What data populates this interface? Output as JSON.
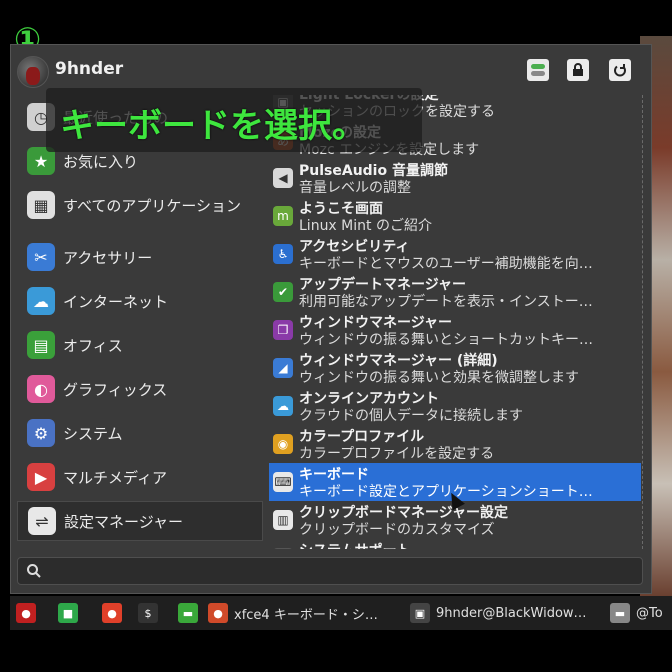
{
  "step_badge": "①",
  "user": {
    "name": "9hnder"
  },
  "overlay_caption": "キーボードを選択。",
  "categories": [
    {
      "label": "最近使ったもの",
      "icon": "clock-icon",
      "color": "#d0d0d0"
    },
    {
      "label": "お気に入り",
      "icon": "star-folder-icon",
      "color": "#3a9a3a"
    },
    {
      "label": "すべてのアプリケーション",
      "icon": "grid-icon",
      "color": "#e0e0e0"
    },
    {
      "label": "アクセサリー",
      "icon": "scissors-icon",
      "color": "#3a7bd5"
    },
    {
      "label": "インターネット",
      "icon": "cloud-icon",
      "color": "#3a9ad8"
    },
    {
      "label": "オフィス",
      "icon": "document-icon",
      "color": "#3aa03a"
    },
    {
      "label": "グラフィックス",
      "icon": "palette-icon",
      "color": "#e05a9a"
    },
    {
      "label": "システム",
      "icon": "gear-icon",
      "color": "#4a72c4"
    },
    {
      "label": "マルチメディア",
      "icon": "play-icon",
      "color": "#d84040"
    },
    {
      "label": "設定マネージャー",
      "icon": "settings-toggle-icon",
      "color": "#e8e8e8"
    }
  ],
  "apps": [
    {
      "title": "Light Lockerの設定",
      "desc": "セッションのロックを設定する",
      "icon": "lock-icon",
      "color": "#555"
    },
    {
      "title": "Mozcの設定",
      "desc": "Mozc エンジンを設定します",
      "icon": "mozc-icon",
      "color": "#c0552a"
    },
    {
      "title": "PulseAudio 音量調節",
      "desc": "音量レベルの調整",
      "icon": "speaker-icon",
      "color": "#d8d8d8"
    },
    {
      "title": "ようこそ画面",
      "desc": "Linux Mint のご紹介",
      "icon": "mint-icon",
      "color": "#69a83a"
    },
    {
      "title": "アクセシビリティ",
      "desc": "キーボードとマウスのユーザー補助機能を向…",
      "icon": "accessibility-icon",
      "color": "#2b6fd0"
    },
    {
      "title": "アップデートマネージャー",
      "desc": "利用可能なアップデートを表示・インストー…",
      "icon": "shield-icon",
      "color": "#3a9a3a"
    },
    {
      "title": "ウィンドウマネージャー",
      "desc": "ウィンドウの振る舞いとショートカットキー…",
      "icon": "windows-icon",
      "color": "#8a3aa8"
    },
    {
      "title": "ウィンドウマネージャー (詳細)",
      "desc": "ウィンドウの振る舞いと効果を微調整します",
      "icon": "window-tweak-icon",
      "color": "#3a7bd5"
    },
    {
      "title": "オンラインアカウント",
      "desc": "クラウドの個人データに接続します",
      "icon": "cloud-icon",
      "color": "#3a9ad8"
    },
    {
      "title": "カラープロファイル",
      "desc": "カラープロファイルを設定する",
      "icon": "color-wheel-icon",
      "color": "#e0a020"
    },
    {
      "title": "キーボード",
      "desc": "キーボード設定とアプリケーションショート…",
      "icon": "keyboard-icon",
      "color": "#e8e8e8",
      "selected": true
    },
    {
      "title": "クリップボードマネージャー設定",
      "desc": "クリップボードのカスタマイズ",
      "icon": "clipboard-icon",
      "color": "#e8e8e8"
    },
    {
      "title": "システムサポート",
      "desc": "",
      "icon": "support-icon",
      "color": "#555"
    }
  ],
  "taskbar": {
    "items": [
      {
        "label": "",
        "icon": "deadpool-icon",
        "color": "#c02020"
      },
      {
        "label": "",
        "icon": "workspace-icon",
        "color": "#2ea84a"
      },
      {
        "label": "",
        "icon": "firefox-icon",
        "color": "#e0402a"
      },
      {
        "label": "",
        "icon": "terminal-icon",
        "color": "#333"
      },
      {
        "label": "",
        "icon": "folder-icon",
        "color": "#3aa83a"
      },
      {
        "label": "xfce4 キーボード・シ…",
        "icon": "firefox-small-icon",
        "color": "#d04a2a"
      },
      {
        "label": "9hnder@BlackWidow…",
        "icon": "terminal-small-icon",
        "color": "#444"
      },
      {
        "label": "@To",
        "icon": "folder-small-icon",
        "color": "#888"
      }
    ]
  }
}
